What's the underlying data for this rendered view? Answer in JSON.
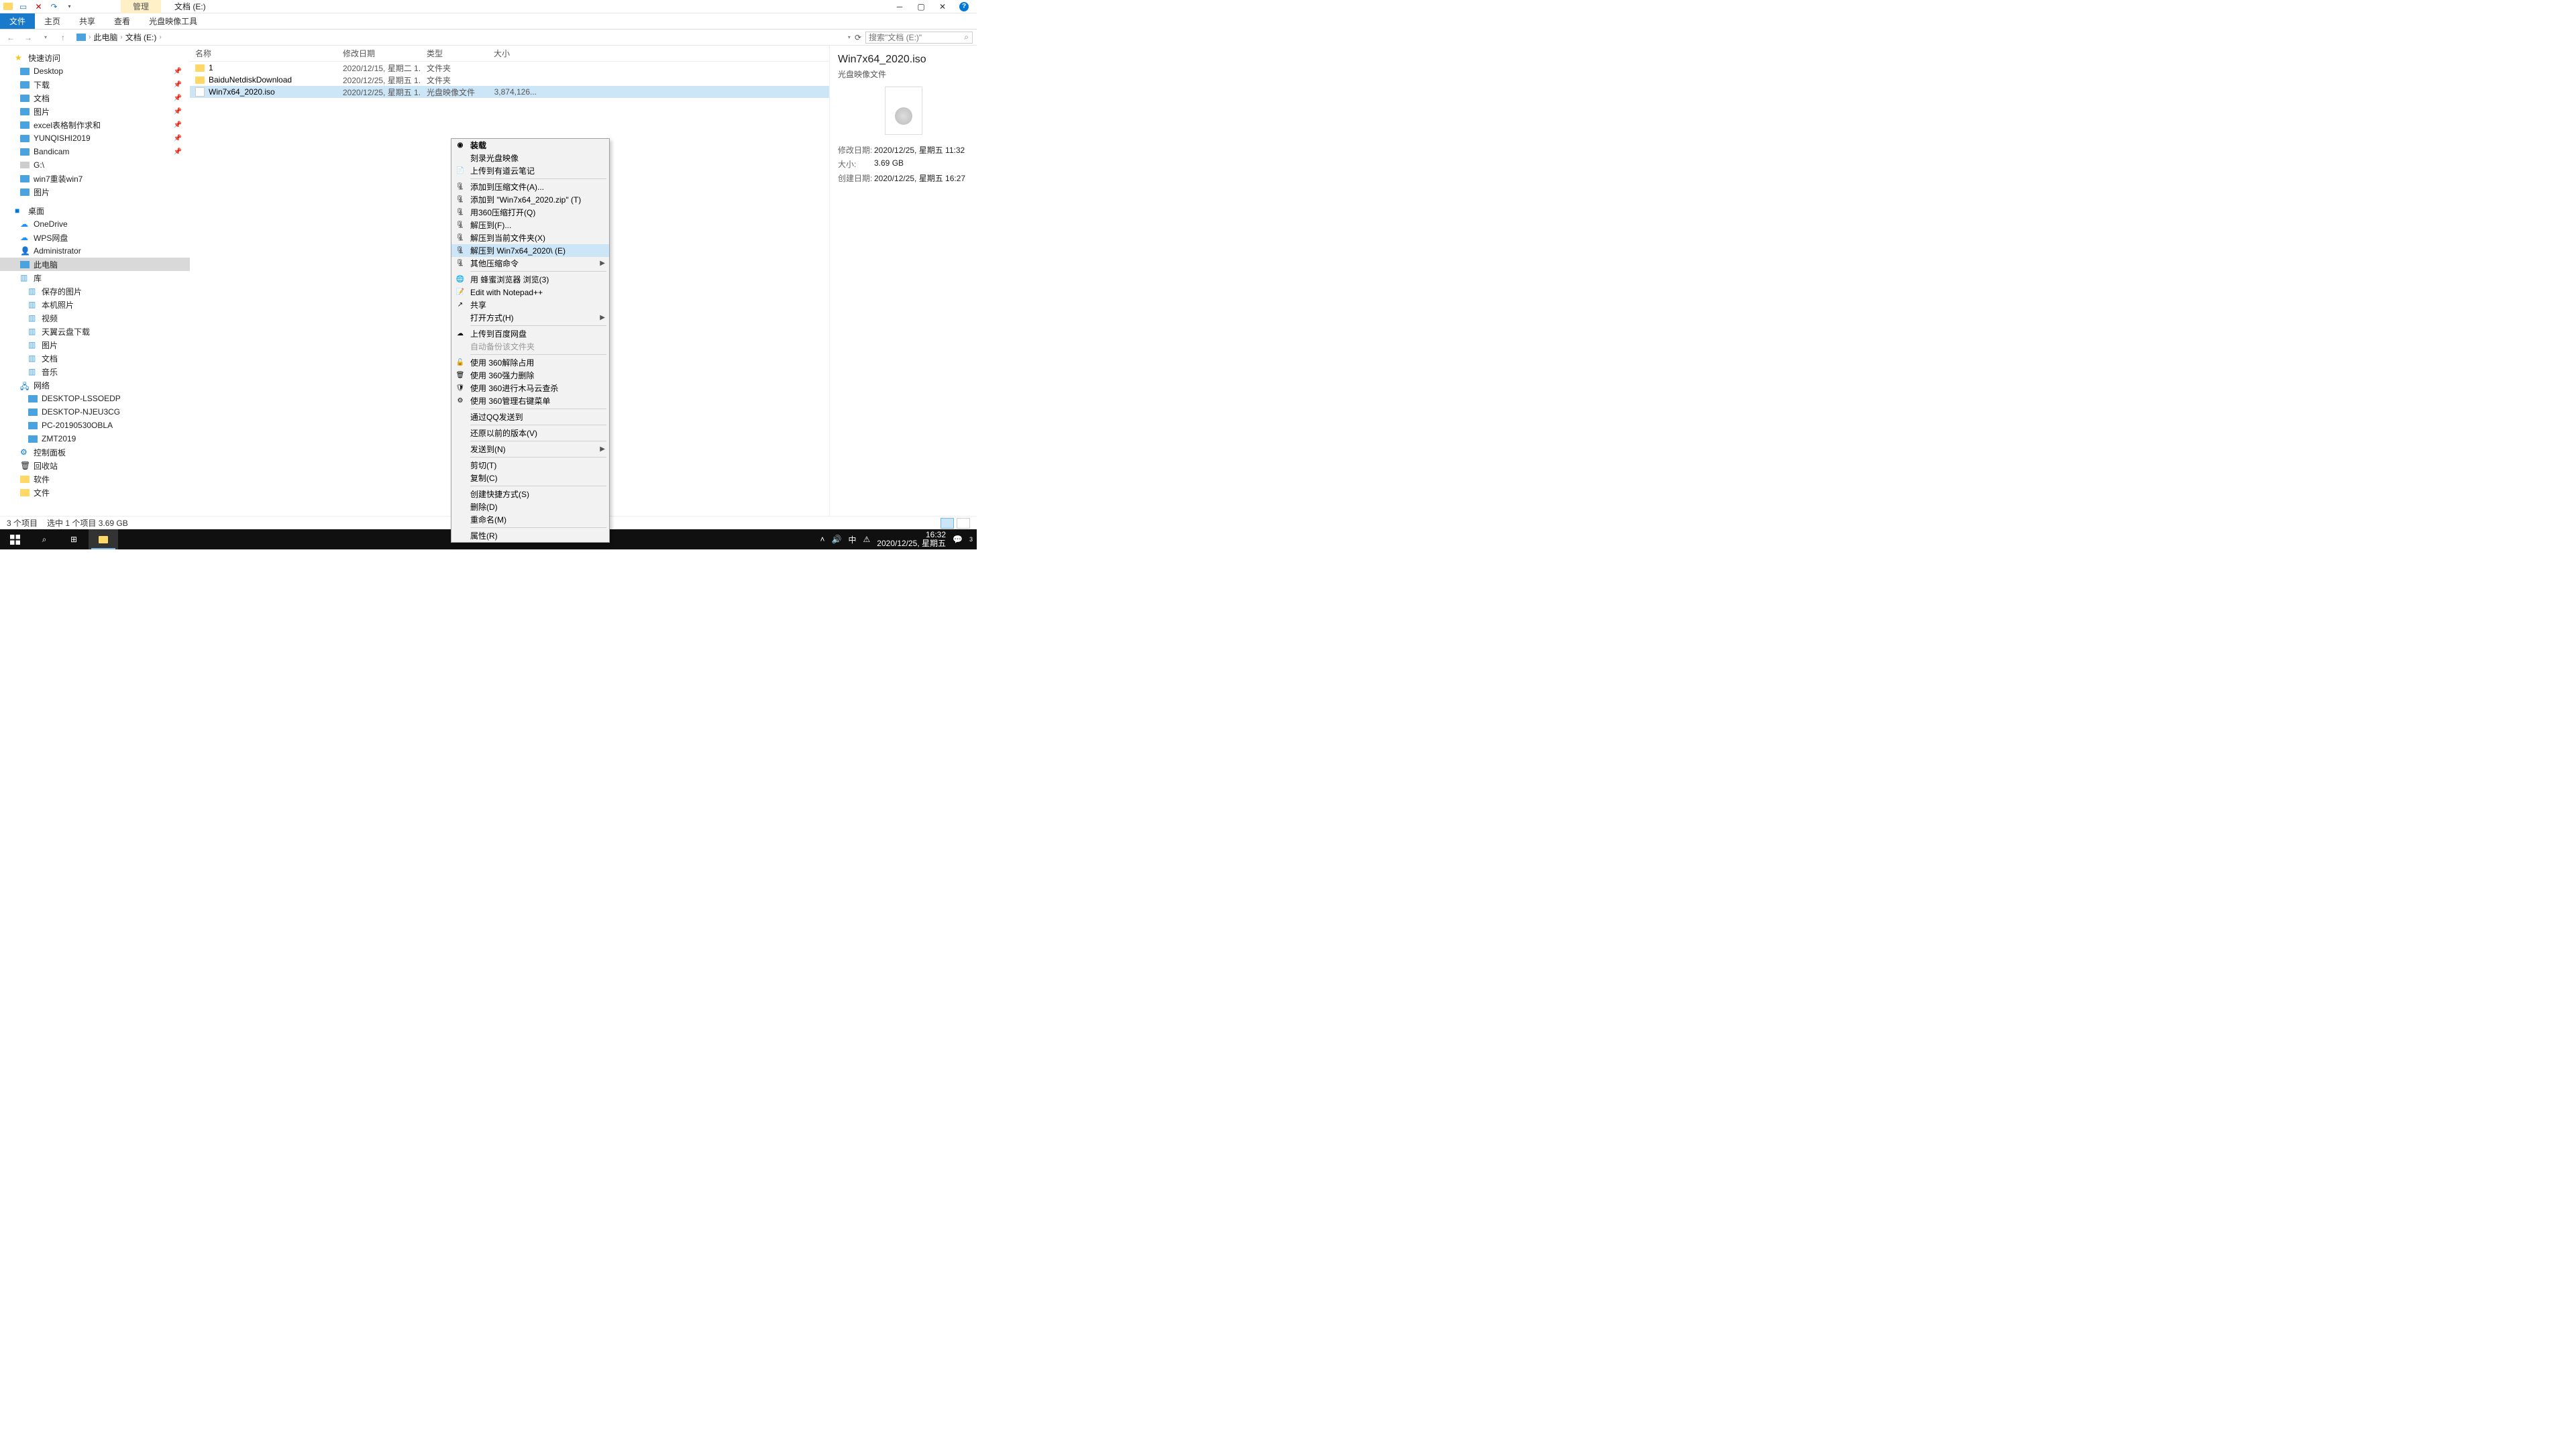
{
  "window": {
    "title_tab": "管理",
    "path_title": "文档 (E:)",
    "ribbon": {
      "file": "文件",
      "home": "主页",
      "share": "共享",
      "view": "查看",
      "iso_tools": "光盘映像工具"
    },
    "breadcrumb": [
      "此电脑",
      "文档 (E:)"
    ],
    "search_placeholder": "搜索\"文档 (E:)\""
  },
  "tree": {
    "quick_access": "快速访问",
    "qa_items": [
      "Desktop",
      "下载",
      "文档",
      "图片",
      "excel表格制作求和",
      "YUNQISHI2019",
      "Bandicam",
      "G:\\",
      "win7重装win7",
      "图片"
    ],
    "desktop": "桌面",
    "desktop_items": [
      "OneDrive",
      "WPS网盘",
      "Administrator",
      "此电脑",
      "库"
    ],
    "lib_items": [
      "保存的图片",
      "本机照片",
      "视频",
      "天翼云盘下载",
      "图片",
      "文档",
      "音乐"
    ],
    "network": "网络",
    "net_items": [
      "DESKTOP-LSSOEDP",
      "DESKTOP-NJEU3CG",
      "PC-20190530OBLA",
      "ZMT2019"
    ],
    "control_panel": "控制面板",
    "recycle": "回收站",
    "software": "软件",
    "files_folder": "文件"
  },
  "columns": {
    "name": "名称",
    "date": "修改日期",
    "type": "类型",
    "size": "大小"
  },
  "rows": [
    {
      "name": "1",
      "date": "2020/12/15, 星期二 1...",
      "type": "文件夹",
      "size": "",
      "is_folder": true
    },
    {
      "name": "BaiduNetdiskDownload",
      "date": "2020/12/25, 星期五 1...",
      "type": "文件夹",
      "size": "",
      "is_folder": true
    },
    {
      "name": "Win7x64_2020.iso",
      "date": "2020/12/25, 星期五 1...",
      "type": "光盘映像文件",
      "size": "3,874,126...",
      "is_folder": false,
      "selected": true
    }
  ],
  "context_menu": [
    {
      "label": "装载",
      "bold": true,
      "icon": "disc"
    },
    {
      "label": "刻录光盘映像"
    },
    {
      "label": "上传到有道云笔记",
      "icon": "note-blue"
    },
    {
      "sep": true
    },
    {
      "label": "添加到压缩文件(A)...",
      "icon": "archive"
    },
    {
      "label": "添加到 \"Win7x64_2020.zip\" (T)",
      "icon": "archive"
    },
    {
      "label": "用360压缩打开(Q)",
      "icon": "archive"
    },
    {
      "label": "解压到(F)...",
      "icon": "archive"
    },
    {
      "label": "解压到当前文件夹(X)",
      "icon": "archive"
    },
    {
      "label": "解压到 Win7x64_2020\\ (E)",
      "icon": "archive",
      "hover": true
    },
    {
      "label": "其他压缩命令",
      "icon": "archive",
      "arrow": true
    },
    {
      "sep": true
    },
    {
      "label": "用 蜂蜜浏览器 浏览(3)",
      "icon": "browser"
    },
    {
      "label": "Edit with Notepad++",
      "icon": "npp"
    },
    {
      "label": "共享",
      "icon": "share"
    },
    {
      "label": "打开方式(H)",
      "arrow": true
    },
    {
      "sep": true
    },
    {
      "label": "上传到百度网盘",
      "icon": "baidu"
    },
    {
      "label": "自动备份该文件夹",
      "disabled": true
    },
    {
      "sep": true
    },
    {
      "label": "使用 360解除占用",
      "icon": "360-unlock"
    },
    {
      "label": "使用 360强力删除",
      "icon": "360-del"
    },
    {
      "label": "使用 360进行木马云查杀",
      "icon": "360-scan"
    },
    {
      "label": "使用 360管理右键菜单",
      "icon": "360-menu"
    },
    {
      "sep": true
    },
    {
      "label": "通过QQ发送到"
    },
    {
      "sep": true
    },
    {
      "label": "还原以前的版本(V)"
    },
    {
      "sep": true
    },
    {
      "label": "发送到(N)",
      "arrow": true
    },
    {
      "sep": true
    },
    {
      "label": "剪切(T)"
    },
    {
      "label": "复制(C)"
    },
    {
      "sep": true
    },
    {
      "label": "创建快捷方式(S)"
    },
    {
      "label": "删除(D)"
    },
    {
      "label": "重命名(M)"
    },
    {
      "sep": true
    },
    {
      "label": "属性(R)"
    }
  ],
  "details": {
    "title": "Win7x64_2020.iso",
    "type": "光盘映像文件",
    "rows": [
      {
        "label": "修改日期:",
        "value": "2020/12/25, 星期五 11:32"
      },
      {
        "label": "大小:",
        "value": "3.69 GB"
      },
      {
        "label": "创建日期:",
        "value": "2020/12/25, 星期五 16:27"
      }
    ]
  },
  "status": {
    "count": "3 个项目",
    "selected": "选中 1 个项目  3.69 GB"
  },
  "taskbar": {
    "ime": "中",
    "time": "16:32",
    "date": "2020/12/25, 星期五",
    "notif": "3"
  }
}
